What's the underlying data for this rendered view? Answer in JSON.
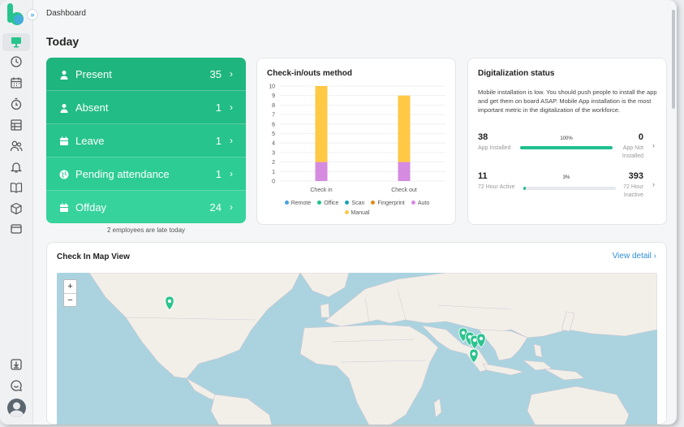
{
  "breadcrumb": "Dashboard",
  "page_title": "Today",
  "attendance": [
    {
      "label": "Present",
      "count": "35",
      "icon": "person-icon",
      "color": "#1fb57e"
    },
    {
      "label": "Absent",
      "count": "1",
      "icon": "person-icon",
      "color": "#22bd86"
    },
    {
      "label": "Leave",
      "count": "1",
      "icon": "calendar-icon",
      "color": "#27c48d"
    },
    {
      "label": "Pending attendance",
      "count": "1",
      "icon": "globe-icon",
      "color": "#2dcc95"
    },
    {
      "label": "Offday",
      "count": "24",
      "icon": "calendar-icon",
      "color": "#36d39d"
    }
  ],
  "late_note": "2 employees are late today",
  "checkin_card": {
    "title": "Check-in/outs method",
    "legend": [
      {
        "name": "Remote",
        "color": "#4a9fe0"
      },
      {
        "name": "Office",
        "color": "#1fc08d"
      },
      {
        "name": "Scan",
        "color": "#17a2b8"
      },
      {
        "name": "Fingerprint",
        "color": "#e08a1e"
      },
      {
        "name": "Auto",
        "color": "#d58be0"
      },
      {
        "name": "Manual",
        "color": "#ffc845"
      }
    ]
  },
  "chart_data": {
    "type": "bar",
    "stacked": true,
    "categories": [
      "Check in",
      "Check out"
    ],
    "ylim": [
      0,
      10
    ],
    "yticks": [
      0,
      1,
      2,
      3,
      4,
      5,
      6,
      7,
      8,
      9,
      10
    ],
    "grid": true,
    "legend_position": "bottom",
    "series": [
      {
        "name": "Remote",
        "values": [
          0,
          0
        ],
        "color": "#4a9fe0"
      },
      {
        "name": "Office",
        "values": [
          0,
          0
        ],
        "color": "#1fc08d"
      },
      {
        "name": "Scan",
        "values": [
          0,
          0
        ],
        "color": "#17a2b8"
      },
      {
        "name": "Fingerprint",
        "values": [
          0,
          0
        ],
        "color": "#e08a1e"
      },
      {
        "name": "Auto",
        "values": [
          2,
          2
        ],
        "color": "#d58be0"
      },
      {
        "name": "Manual",
        "values": [
          8,
          7
        ],
        "color": "#ffc845"
      }
    ]
  },
  "digitalization": {
    "title": "Digitalization status",
    "description": "Mobile installation is low. You should push people to install the app and get them on board ASAP. Mobile App installation is the most important metric in the digitalization of the workforce.",
    "metrics": [
      {
        "left_value": "38",
        "left_label": "App Installed",
        "percent_label": "100%",
        "progress": 1.0,
        "right_value": "0",
        "right_label_1": "App Not",
        "right_label_2": "Installed"
      },
      {
        "left_value": "11",
        "left_label": "72 Hour Active",
        "percent_label": "3%",
        "progress": 0.03,
        "right_value": "393",
        "right_label_1": "72 Hour",
        "right_label_2": "Inactive"
      }
    ]
  },
  "map_card": {
    "title": "Check In Map View",
    "view_detail": "View detail",
    "zoom_in": "+",
    "zoom_out": "−",
    "marker_color": "#2cc38f"
  }
}
